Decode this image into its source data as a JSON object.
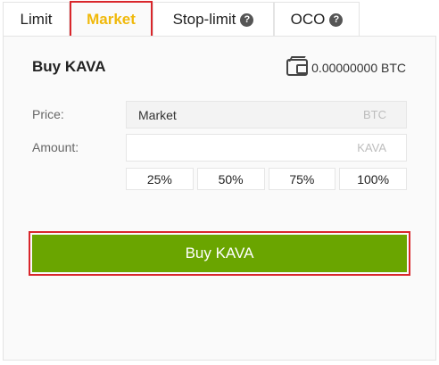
{
  "tabs": [
    {
      "label": "Limit"
    },
    {
      "label": "Market",
      "active": true
    },
    {
      "label": "Stop-limit",
      "help": "?"
    },
    {
      "label": "OCO",
      "help": "?"
    }
  ],
  "form": {
    "title": "Buy KAVA",
    "balance": "0.00000000 BTC",
    "price_label": "Price:",
    "price_value": "Market",
    "price_unit": "BTC",
    "amount_label": "Amount:",
    "amount_value": "",
    "amount_unit": "KAVA",
    "percent_buttons": [
      "25%",
      "50%",
      "75%",
      "100%"
    ],
    "buy_button": "Buy KAVA"
  },
  "colors": {
    "active_tab": "#f0b90b",
    "buy_button": "#6aa500",
    "highlight": "#d9262b"
  }
}
